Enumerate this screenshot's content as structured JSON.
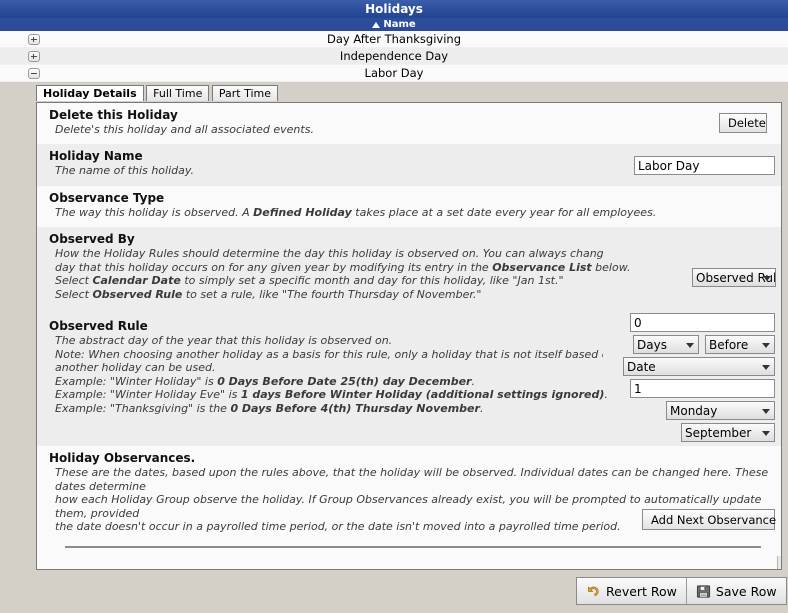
{
  "window": {
    "title": "Holidays"
  },
  "grid": {
    "sort_column": "Name",
    "sort_direction": "ascending",
    "rows": [
      {
        "name": "Day After Thanksgiving",
        "expander": "+"
      },
      {
        "name": "Independence Day",
        "expander": "+"
      },
      {
        "name": "Labor Day",
        "expander": "-"
      }
    ]
  },
  "tabs": [
    {
      "label": "Holiday Details",
      "active": true
    },
    {
      "label": "Full Time",
      "active": false
    },
    {
      "label": "Part Time",
      "active": false
    }
  ],
  "sections": {
    "delete": {
      "title": "Delete this Holiday",
      "desc": "Delete's this holiday and all associated events.",
      "button": "Delete"
    },
    "holiday_name": {
      "title": "Holiday Name",
      "desc": "The name of this holiday.",
      "value": "Labor Day"
    },
    "observance_type": {
      "title": "Observance Type",
      "desc_pre": "The way this holiday is observed. A ",
      "desc_bold": "Defined Holiday",
      "desc_post": " takes place at a set date every year for all employees."
    },
    "observed_by": {
      "title": "Observed By",
      "line1_a": "How the Holiday Rules should determine the day this holiday is observed on. You can always change the actual",
      "line2_a": "day that this holiday occurs on for any given year by modifying its entry in the ",
      "line2_b": "Observance List",
      "line2_c": " below.",
      "line3_a": "Select ",
      "line3_b": "Calendar Date",
      "line3_c": " to simply set a specific month and day for this holiday, like \"Jan 1st.\"",
      "line4_a": "Select ",
      "line4_b": "Observed Rule",
      "line4_c": " to set a rule, like \"The fourth Thursday of November.\"",
      "selected": "Observed Rule"
    },
    "observed_rule": {
      "title": "Observed Rule",
      "line1": "The abstract day of the year that this holiday is observed on.",
      "line2": "Note: When choosing another holiday as a basis for this rule, only a holiday that is not itself based on the date of",
      "line3": "another holiday can be used.",
      "ex1_a": "Example: \"Winter Holiday\" is ",
      "ex1_b": "0 Days Before Date 25(th) day December",
      "ex1_c": ".",
      "ex2_a": "Example: \"Winter Holiday Eve\" is ",
      "ex2_b": "1 days Before Winter Holiday (additional settings ignored)",
      "ex2_c": ".",
      "ex3_a": "Example: \"Thanksgiving\" is the ",
      "ex3_b": "0 Days Before 4(th) Thursday November",
      "ex3_c": ".",
      "offset_value": "0",
      "unit": "Days",
      "direction": "Before",
      "basis": "Date",
      "ordinal_value": "1",
      "weekday": "Monday",
      "month": "September"
    },
    "observances": {
      "title": "Holiday Observances.",
      "line1": "These are the dates, based upon the rules above, that the holiday will be observed. Individual dates can be changed here. These dates determine",
      "line2": "how each Holiday Group observe the holiday. If Group Observances already exist, you will be prompted to automatically update them, provided",
      "line3": "the date doesn't occur in a payrolled time period, or the date isn't moved into a payrolled time period.",
      "button": "Add Next Observance"
    }
  },
  "footer": {
    "revert_label": "Revert Row",
    "save_label": "Save Row"
  },
  "colors": {
    "header_blue": "#2d4f9e",
    "section_light": "#fafafa",
    "section_dark": "#ededed",
    "window_chrome": "#d4d0c8",
    "revert_icon": "#e8a33d",
    "save_icon": "#4a4a4a"
  }
}
